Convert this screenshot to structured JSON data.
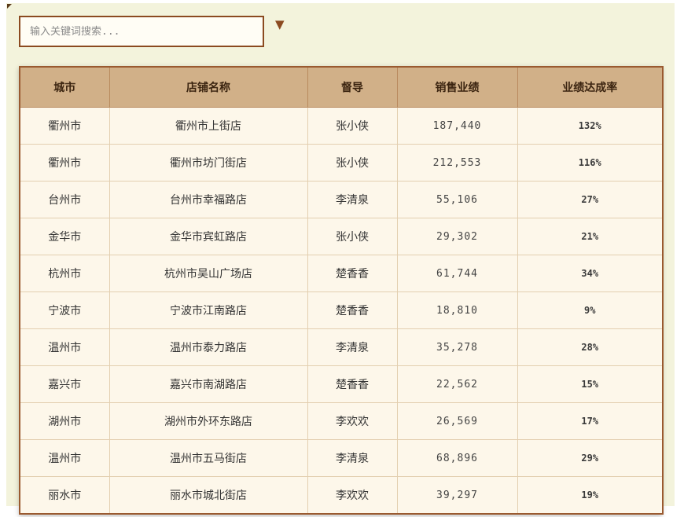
{
  "search": {
    "placeholder": "输入关键词搜索..."
  },
  "toggle": {
    "icon": "▼"
  },
  "table": {
    "headers": [
      "城市",
      "店铺名称",
      "督导",
      "销售业绩",
      "业绩达成率"
    ],
    "rows": [
      [
        "衢州市",
        "衢州市上街店",
        "张小侠",
        "187,440",
        "132%"
      ],
      [
        "衢州市",
        "衢州市坊门街店",
        "张小侠",
        "212,553",
        "116%"
      ],
      [
        "台州市",
        "台州市幸福路店",
        "李清泉",
        "55,106",
        "27%"
      ],
      [
        "金华市",
        "金华市宾虹路店",
        "张小侠",
        "29,302",
        "21%"
      ],
      [
        "杭州市",
        "杭州市吴山广场店",
        "楚香香",
        "61,744",
        "34%"
      ],
      [
        "宁波市",
        "宁波市江南路店",
        "楚香香",
        "18,810",
        "9%"
      ],
      [
        "温州市",
        "温州市泰力路店",
        "李清泉",
        "35,278",
        "28%"
      ],
      [
        "嘉兴市",
        "嘉兴市南湖路店",
        "楚香香",
        "22,562",
        "15%"
      ],
      [
        "湖州市",
        "湖州市外环东路店",
        "李欢欢",
        "26,569",
        "17%"
      ],
      [
        "温州市",
        "温州市五马街店",
        "李清泉",
        "68,896",
        "29%"
      ],
      [
        "丽水市",
        "丽水市城北街店",
        "李欢欢",
        "39,297",
        "19%"
      ]
    ]
  }
}
